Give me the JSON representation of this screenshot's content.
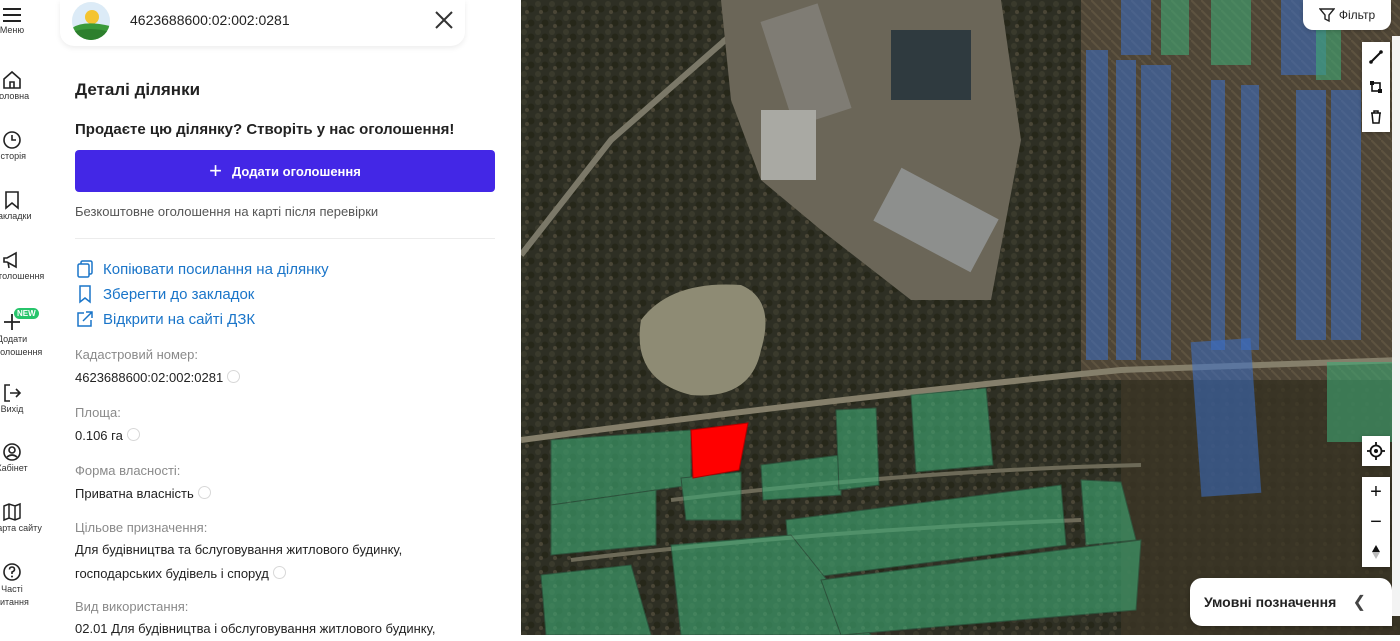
{
  "rail": {
    "items": [
      {
        "icon": "menu-icon",
        "label": "Меню"
      },
      {
        "icon": "home-icon",
        "label": "Головна"
      },
      {
        "icon": "history-icon",
        "label": "Історія"
      },
      {
        "icon": "bookmark-icon",
        "label": "Закладки"
      },
      {
        "icon": "megaphone-icon",
        "label": "Оголошення"
      },
      {
        "icon": "plus-icon",
        "label": "Додати оголошення",
        "badge": "NEW"
      },
      {
        "icon": "logout-icon",
        "label": "Вихід"
      },
      {
        "icon": "user-icon",
        "label": "Кабінет"
      },
      {
        "icon": "map-icon",
        "label": "Карта сайту"
      },
      {
        "icon": "help-icon",
        "label": "Часті питання"
      }
    ]
  },
  "header": {
    "cadastral_number": "4623688600:02:002:0281"
  },
  "details": {
    "title": "Деталі ділянки",
    "promo": "Продаєте цю ділянку? Створіть у нас оголошення!",
    "add_button": "Додати оголошення",
    "free_note": "Безкоштовне оголошення на карті після перевірки",
    "links": {
      "copy": "Копіювати посилання на ділянку",
      "save": "Зберегти до закладок",
      "open": "Відкрити на сайті ДЗК"
    },
    "fields": {
      "cadastral_label": "Кадастровий номер:",
      "cadastral_value": "4623688600:02:002:0281",
      "area_label": "Площа:",
      "area_value": "0.106 га",
      "ownership_label": "Форма власності:",
      "ownership_value": "Приватна власність",
      "purpose_label": "Цільове призначення:",
      "purpose_value_1": "Для будівництва та бслуговування житлового будинку,",
      "purpose_value_2": "господарських будівель і споруд",
      "usage_label": "Вид використання:",
      "usage_value": "02.01 Для будівництва і обслуговування житлового будинку,"
    }
  },
  "map": {
    "filter_label": "Фільтр",
    "legend_label": "Умовні позначення",
    "colors": {
      "parcel_green": "#3fa874",
      "parcel_blue": "#3a6fc8",
      "selected_parcel": "#ff0000",
      "primary_button": "#4327e6",
      "link": "#1a75c9"
    }
  }
}
